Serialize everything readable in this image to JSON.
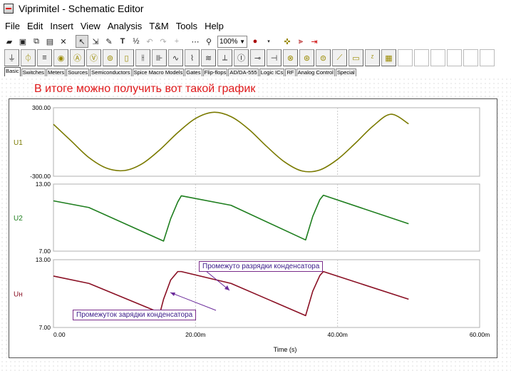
{
  "window": {
    "title": "Viprimitel - Schematic Editor"
  },
  "menu": [
    "File",
    "Edit",
    "Insert",
    "View",
    "Analysis",
    "T&M",
    "Tools",
    "Help"
  ],
  "toolbar": {
    "zoom_value": "100%",
    "icons": [
      "open-icon",
      "save-icon",
      "copy-icon",
      "paste-icon",
      "delete-icon",
      "pointer-icon",
      "wire-icon",
      "pencil-icon",
      "text-icon",
      "fraction-icon",
      "undo-icon",
      "redo-icon",
      "grid-icon",
      "zoom-icon",
      "ac-source-icon",
      "probe-icon",
      "analysis-icon",
      "run-icon"
    ]
  },
  "components": {
    "icons": [
      "ground-icon",
      "capacitor-source-icon",
      "battery-icon",
      "lamp-icon",
      "ammeter-icon",
      "voltmeter-icon",
      "probe-icon",
      "resistor-icon",
      "capacitor-icon",
      "inductor-icon",
      "transformer-icon",
      "coil-icon",
      "relay-icon",
      "switch-icon",
      "meter-icon",
      "diode-icon",
      "led-icon",
      "fuse-icon",
      "transistor-icon",
      "chip-icon"
    ]
  },
  "tabs": [
    "Basic",
    "Switches",
    "Meters",
    "Sources",
    "Semiconductors",
    "Spice Macro Models",
    "Gates",
    "Flip-flops",
    "AD/DA-555",
    "Logic ICs",
    "RF",
    "Analog Control",
    "Special"
  ],
  "caption": "В итоге можно получить вот такой график",
  "chart_data": {
    "type": "line",
    "xlabel": "Time (s)",
    "x_ticks": [
      "0.00",
      "20.00m",
      "40.00m",
      "60.00m"
    ],
    "xlim": [
      0,
      0.06
    ],
    "panels": [
      {
        "name": "U1",
        "color": "#7a7a00",
        "ylim": [
          -300,
          300
        ],
        "y_ticks": [
          "300.00",
          "-300.00"
        ],
        "x": [
          0,
          0.0025,
          0.005,
          0.0075,
          0.01,
          0.0125,
          0.015,
          0.0175,
          0.02,
          0.0225,
          0.025,
          0.0275,
          0.03,
          0.0325,
          0.035,
          0.0375,
          0.04,
          0.0425,
          0.045,
          0.0475,
          0.05
        ],
        "y": [
          155,
          9,
          -137,
          -230,
          -250,
          -190,
          -67,
          82,
          206,
          260,
          222,
          111,
          -38,
          -173,
          -254,
          -245,
          -152,
          -11,
          140,
          243,
          159
        ]
      },
      {
        "name": "U2",
        "color": "#1e7e1e",
        "ylim": [
          7,
          13
        ],
        "y_ticks": [
          "13.00",
          "7.00"
        ],
        "x": [
          0,
          0.005,
          0.0155,
          0.0165,
          0.0175,
          0.018,
          0.025,
          0.0355,
          0.0365,
          0.0375,
          0.038,
          0.05
        ],
        "y": [
          11.5,
          10.9,
          7.9,
          9.9,
          11.4,
          11.95,
          11.1,
          8.0,
          10.1,
          11.6,
          12.0,
          9.45
        ]
      },
      {
        "name": "Uн",
        "color": "#8a1024",
        "ylim": [
          7,
          13
        ],
        "y_ticks": [
          "13.00",
          "7.00"
        ],
        "x": [
          0,
          0.005,
          0.015,
          0.0155,
          0.0165,
          0.0175,
          0.018,
          0.025,
          0.0355,
          0.0365,
          0.0375,
          0.038,
          0.05
        ],
        "y": [
          11.55,
          10.9,
          8.3,
          9.5,
          11.2,
          11.95,
          11.95,
          10.9,
          8.05,
          10.2,
          11.6,
          11.95,
          9.5
        ]
      }
    ],
    "annotations": [
      "Промежуто разрядки конденсатора",
      "Промежуток зарядки конденсатора"
    ]
  }
}
